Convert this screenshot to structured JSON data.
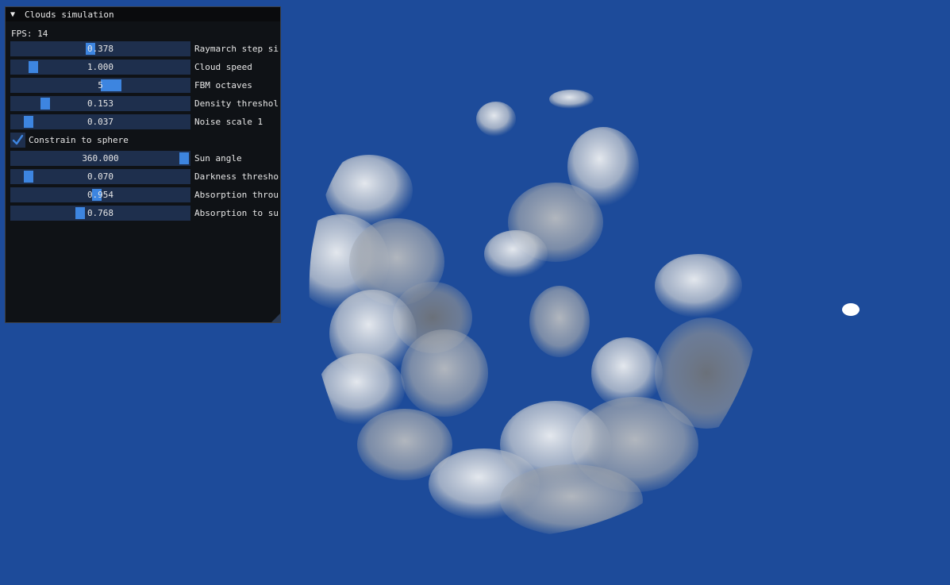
{
  "window": {
    "title": "Clouds simulation",
    "fps_label": "FPS: 14"
  },
  "controls": {
    "raymarch_step": {
      "value": "0.378",
      "label": "Raymarch step si",
      "position": 0.44
    },
    "cloud_speed": {
      "value": "1.000",
      "label": "Cloud speed",
      "position": 0.1
    },
    "fbm_octaves": {
      "value": "5",
      "label": "FBM octaves",
      "position": 0.57
    },
    "density_threshold": {
      "value": "0.153",
      "label": "Density threshol",
      "position": 0.17
    },
    "noise_scale": {
      "value": "0.037",
      "label": "Noise scale 1",
      "position": 0.07
    },
    "constrain_to_sphere": {
      "label": "Constrain to sphere",
      "checked": true
    },
    "sun_angle": {
      "value": "360.000",
      "label": "Sun angle",
      "position": 1.0
    },
    "darkness_threshold": {
      "value": "0.070",
      "label": "Darkness thresho",
      "position": 0.07
    },
    "absorption_through": {
      "value": "0.954",
      "label": "Absorption throu",
      "position": 0.48
    },
    "absorption_to_sun": {
      "value": "0.768",
      "label": "Absorption to su",
      "position": 0.38
    }
  },
  "colors": {
    "sky_background": "#1d4b9a",
    "accent": "#3d85e0",
    "frame_bg": "#1e2f4d",
    "panel_bg": "#0f1216"
  }
}
